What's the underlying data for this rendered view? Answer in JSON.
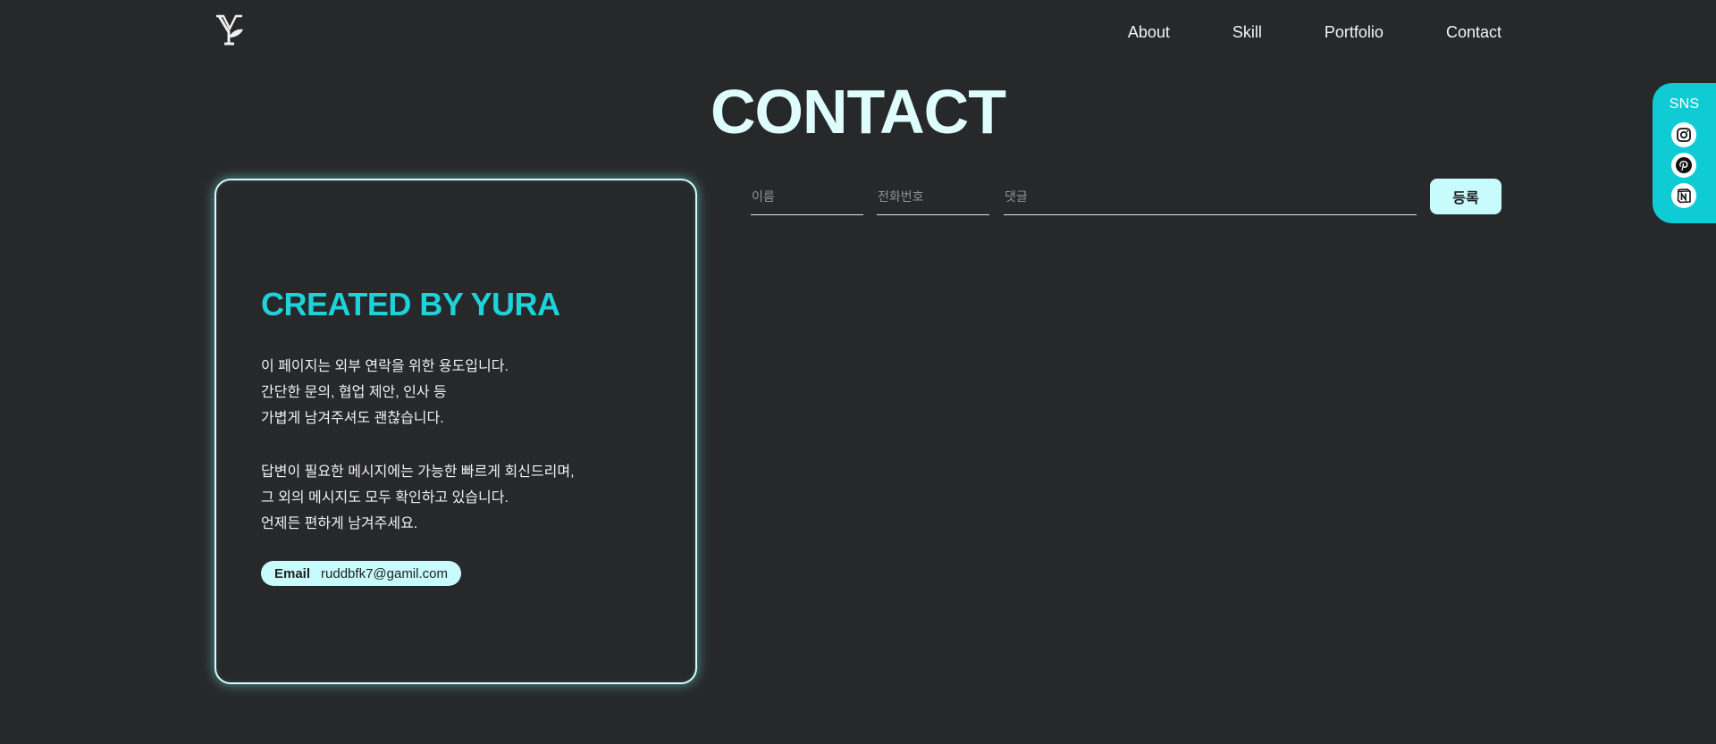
{
  "header": {
    "logo_text": "Y",
    "nav": [
      "About",
      "Skill",
      "Portfolio",
      "Contact"
    ]
  },
  "page_title": "CONTACT",
  "card": {
    "title": "CREATED BY YURA",
    "paragraph1": [
      "이 페이지는 외부 연락을 위한 용도입니다.",
      "간단한 문의, 협업 제안, 인사 등",
      "가볍게 남겨주셔도 괜찮습니다."
    ],
    "paragraph2": [
      "답변이 필요한 메시지에는 가능한 빠르게 회신드리며,",
      "그 외의 메시지도 모두 확인하고 있습니다.",
      "언제든 편하게 남겨주세요."
    ],
    "email_label": "Email",
    "email_value": "ruddbfk7@gamil.com"
  },
  "form": {
    "name_placeholder": "이름",
    "phone_placeholder": "전화번호",
    "comment_placeholder": "댓글",
    "submit_label": "등록"
  },
  "sns": {
    "label": "SNS",
    "icons": [
      "instagram-icon",
      "pinterest-icon",
      "notion-icon"
    ]
  },
  "colors": {
    "background": "#27282a",
    "accent": "#1ed2da",
    "pill": "#c8fbfb",
    "title": "#dffdfd"
  }
}
